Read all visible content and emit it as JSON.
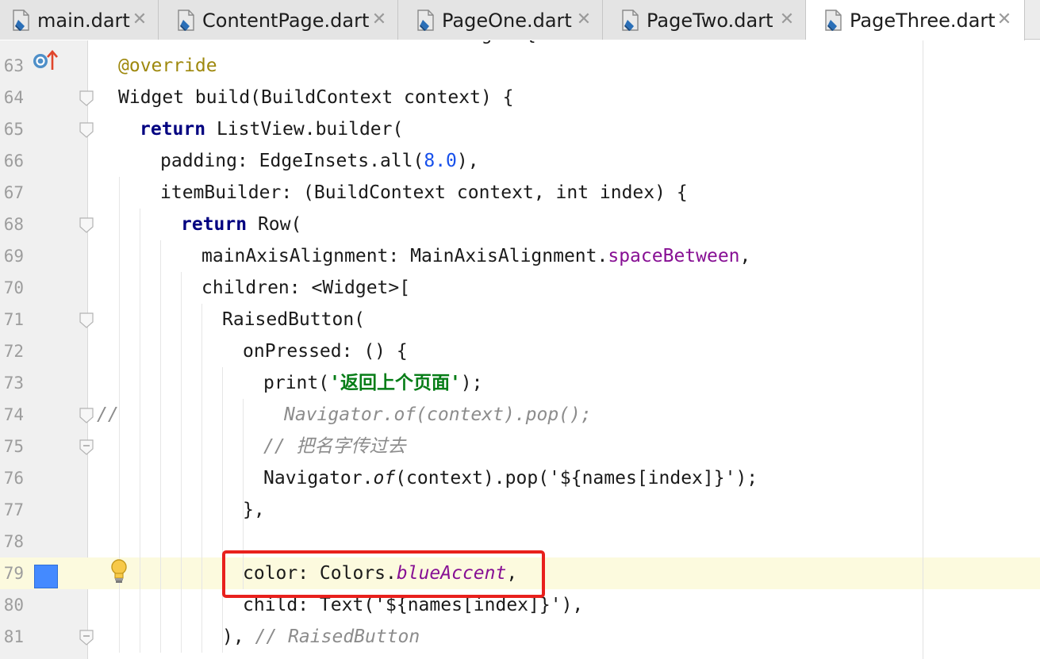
{
  "tabs": [
    {
      "label": "main.dart",
      "active": false
    },
    {
      "label": "ContentPage.dart",
      "active": false
    },
    {
      "label": "PageOne.dart",
      "active": false
    },
    {
      "label": "PageTwo.dart",
      "active": false
    },
    {
      "label": "PageThree.dart",
      "active": true
    }
  ],
  "close_glyph": "✕",
  "icons": {
    "tab_file": "dart-file-icon",
    "close": "close-icon",
    "override": "override-method-icon",
    "fold": "fold-marker-icon",
    "color_preview": "color-swatch-icon",
    "intention": "lightbulb-icon"
  },
  "colors": {
    "accent_swatch": "#448aff",
    "highlight_box": "#e8201d"
  },
  "editor": {
    "top_partial_line": "class Contents extends StatelessWidget {",
    "lines": [
      {
        "num": "63",
        "tokens": [
          {
            "t": "@override",
            "c": "ann"
          }
        ]
      },
      {
        "num": "64",
        "tokens": [
          {
            "t": "Widget build(BuildContext context) {",
            "c": ""
          }
        ]
      },
      {
        "num": "65",
        "tokens": [
          {
            "t": "return",
            "c": "kw"
          },
          {
            "t": " ListView.builder(",
            "c": ""
          }
        ]
      },
      {
        "num": "66",
        "tokens": [
          {
            "t": "padding: EdgeInsets.all(",
            "c": ""
          },
          {
            "t": "8.0",
            "c": "num"
          },
          {
            "t": "),",
            "c": ""
          }
        ]
      },
      {
        "num": "67",
        "tokens": [
          {
            "t": "itemBuilder: (BuildContext context, int index) {",
            "c": ""
          }
        ]
      },
      {
        "num": "68",
        "tokens": [
          {
            "t": "return",
            "c": "kw"
          },
          {
            "t": " Row(",
            "c": ""
          }
        ]
      },
      {
        "num": "69",
        "tokens": [
          {
            "t": "mainAxisAlignment: MainAxisAlignment.",
            "c": ""
          },
          {
            "t": "spaceBetween",
            "c": "prop"
          },
          {
            "t": ",",
            "c": ""
          }
        ]
      },
      {
        "num": "70",
        "tokens": [
          {
            "t": "children: <Widget>[",
            "c": ""
          }
        ]
      },
      {
        "num": "71",
        "tokens": [
          {
            "t": "RaisedButton(",
            "c": ""
          }
        ]
      },
      {
        "num": "72",
        "tokens": [
          {
            "t": "onPressed: () {",
            "c": ""
          }
        ]
      },
      {
        "num": "73",
        "tokens": [
          {
            "t": "print(",
            "c": ""
          },
          {
            "t": "'返回上个页面'",
            "c": "str"
          },
          {
            "t": ");",
            "c": ""
          }
        ]
      },
      {
        "num": "74",
        "tokens": [
          {
            "t": "Navigator.of(context).pop();",
            "c": "cmt"
          }
        ]
      },
      {
        "num": "75",
        "tokens": [
          {
            "t": "// 把名字传过去",
            "c": "cmt"
          }
        ]
      },
      {
        "num": "76",
        "tokens": [
          {
            "t": "Navigator.",
            "c": ""
          },
          {
            "t": "of",
            "c": "ital"
          },
          {
            "t": "(context).pop('${names[index]}');",
            "c": ""
          }
        ]
      },
      {
        "num": "77",
        "tokens": [
          {
            "t": "},",
            "c": ""
          }
        ]
      },
      {
        "num": "78",
        "tokens": []
      },
      {
        "num": "79",
        "tokens": [
          {
            "t": "color: Colors.",
            "c": ""
          },
          {
            "t": "blueAccent",
            "c": "prop ital"
          },
          {
            "t": ",",
            "c": ""
          }
        ]
      },
      {
        "num": "80",
        "tokens": [
          {
            "t": "child: Text('${names[index]}'),",
            "c": ""
          }
        ]
      },
      {
        "num": "81",
        "tokens": [
          {
            "t": "), ",
            "c": ""
          },
          {
            "t": "// RaisedButton",
            "c": "cmt"
          }
        ]
      }
    ],
    "commented_prefix_74": "//"
  }
}
